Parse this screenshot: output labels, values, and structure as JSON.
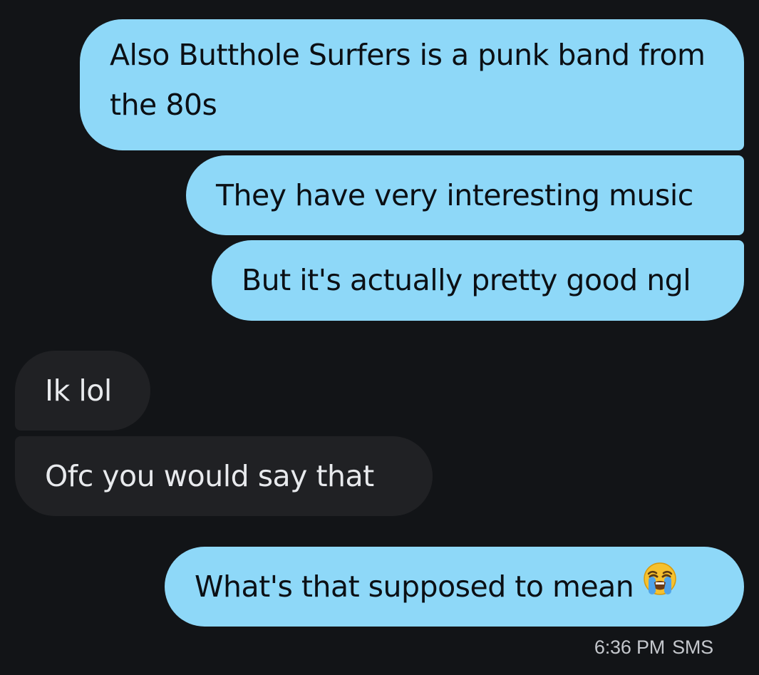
{
  "messages": [
    {
      "direction": "outgoing",
      "text": "Also Butthole Surfers is a punk band from the 80s"
    },
    {
      "direction": "outgoing",
      "text": "They have very interesting music"
    },
    {
      "direction": "outgoing",
      "text": "But it's actually pretty good ngl"
    },
    {
      "direction": "incoming",
      "text": "Ik lol"
    },
    {
      "direction": "incoming",
      "text": "Ofc you would say that"
    },
    {
      "direction": "outgoing",
      "text": "What's that supposed to mean",
      "emoji": "loudly-crying-face-icon"
    }
  ],
  "footer": {
    "time": "6:36 PM",
    "type": "SMS"
  },
  "colors": {
    "background": "#121417",
    "outgoing_bubble": "#8ed8f8",
    "incoming_bubble": "#202124",
    "outgoing_text": "#0b0f14",
    "incoming_text": "#e8eaed"
  }
}
